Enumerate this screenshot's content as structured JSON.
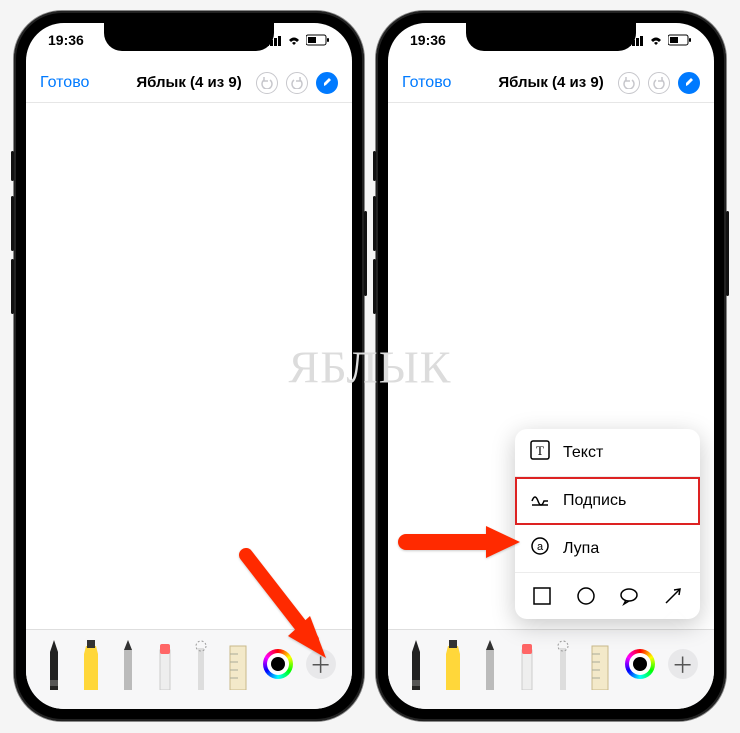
{
  "status": {
    "time": "19:36"
  },
  "nav": {
    "done": "Готово",
    "title": "Яблык (4 из 9)"
  },
  "watermark": "ЯБЛЫК",
  "menu": {
    "text": "Текст",
    "signature": "Подпись",
    "magnifier": "Лупа"
  },
  "tools": [
    "pen",
    "marker",
    "pencil",
    "eraser",
    "lasso",
    "ruler"
  ],
  "colors": {
    "accent": "#007aff",
    "arrow": "#ff2a00"
  }
}
